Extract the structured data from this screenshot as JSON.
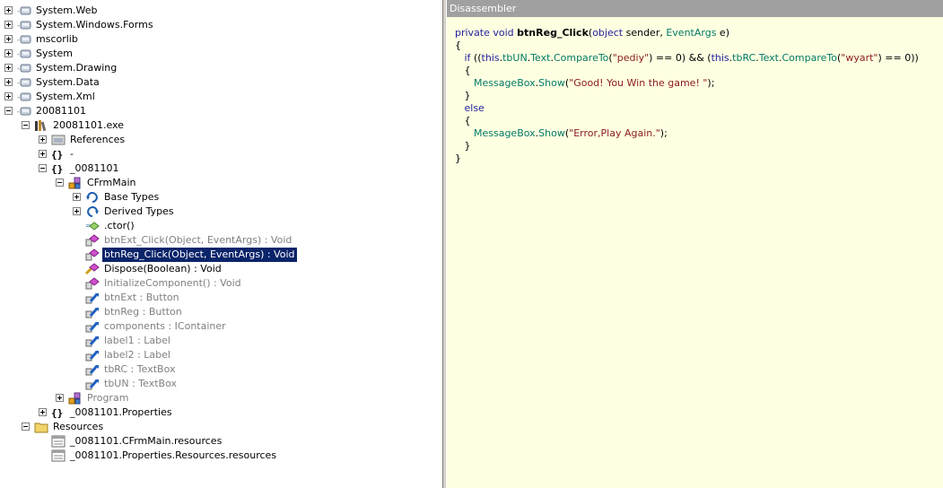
{
  "disassembler": {
    "title": "Disassembler",
    "code": [
      [
        [
          "kw",
          "private "
        ],
        [
          "kw",
          "void "
        ],
        [
          "nm",
          "btnReg_Click"
        ],
        [
          "pl",
          "("
        ],
        [
          "kw",
          "object "
        ],
        [
          "pl",
          "sender, "
        ],
        [
          "ty",
          "EventArgs "
        ],
        [
          "pl",
          "e)"
        ]
      ],
      [
        [
          "pl",
          "{"
        ]
      ],
      [
        [
          "pl",
          "   "
        ],
        [
          "kw",
          "if "
        ],
        [
          "pl",
          "(("
        ],
        [
          "kw",
          "this"
        ],
        [
          "pl",
          "."
        ],
        [
          "mb",
          "tbUN"
        ],
        [
          "pl",
          "."
        ],
        [
          "mb",
          "Text"
        ],
        [
          "pl",
          "."
        ],
        [
          "mb",
          "CompareTo"
        ],
        [
          "pl",
          "("
        ],
        [
          "st",
          "\"pediy\""
        ],
        [
          "pl",
          ") == 0) && ("
        ],
        [
          "kw",
          "this"
        ],
        [
          "pl",
          "."
        ],
        [
          "mb",
          "tbRC"
        ],
        [
          "pl",
          "."
        ],
        [
          "mb",
          "Text"
        ],
        [
          "pl",
          "."
        ],
        [
          "mb",
          "CompareTo"
        ],
        [
          "pl",
          "("
        ],
        [
          "st",
          "\"wyart\""
        ],
        [
          "pl",
          ") == 0))"
        ]
      ],
      [
        [
          "pl",
          "   {"
        ]
      ],
      [
        [
          "pl",
          "      "
        ],
        [
          "ty",
          "MessageBox"
        ],
        [
          "pl",
          "."
        ],
        [
          "mb",
          "Show"
        ],
        [
          "pl",
          "("
        ],
        [
          "st",
          "\"Good! You Win the game! \""
        ],
        [
          "pl",
          ");"
        ]
      ],
      [
        [
          "pl",
          "   }"
        ]
      ],
      [
        [
          "pl",
          "   "
        ],
        [
          "kw",
          "else"
        ]
      ],
      [
        [
          "pl",
          "   {"
        ]
      ],
      [
        [
          "pl",
          "      "
        ],
        [
          "ty",
          "MessageBox"
        ],
        [
          "pl",
          "."
        ],
        [
          "mb",
          "Show"
        ],
        [
          "pl",
          "("
        ],
        [
          "st",
          "\"Error,Play Again.\""
        ],
        [
          "pl",
          ");"
        ]
      ],
      [
        [
          "pl",
          "   }"
        ]
      ],
      [
        [
          "pl",
          "}"
        ]
      ]
    ]
  },
  "tree": [
    {
      "label": "System.Web",
      "icon": "assembly",
      "level": 0,
      "exp": "plus",
      "dim": false
    },
    {
      "label": "System.Windows.Forms",
      "icon": "assembly",
      "level": 0,
      "exp": "plus",
      "dim": false
    },
    {
      "label": "mscorlib",
      "icon": "assembly",
      "level": 0,
      "exp": "plus",
      "dim": false
    },
    {
      "label": "System",
      "icon": "assembly",
      "level": 0,
      "exp": "plus",
      "dim": false
    },
    {
      "label": "System.Drawing",
      "icon": "assembly",
      "level": 0,
      "exp": "plus",
      "dim": false
    },
    {
      "label": "System.Data",
      "icon": "assembly",
      "level": 0,
      "exp": "plus",
      "dim": false
    },
    {
      "label": "System.Xml",
      "icon": "assembly",
      "level": 0,
      "exp": "plus",
      "dim": false
    },
    {
      "label": "20081101",
      "icon": "assembly",
      "level": 0,
      "exp": "minus",
      "dim": false
    },
    {
      "label": "20081101.exe",
      "icon": "module",
      "level": 1,
      "exp": "minus",
      "dim": false
    },
    {
      "label": "References",
      "icon": "references",
      "level": 2,
      "exp": "plus",
      "dim": false
    },
    {
      "label": "-",
      "icon": "namespace",
      "level": 2,
      "exp": "plus",
      "dim": false
    },
    {
      "label": "_0081101",
      "icon": "namespace",
      "level": 2,
      "exp": "minus",
      "dim": false
    },
    {
      "label": "CFrmMain",
      "icon": "class",
      "level": 3,
      "exp": "minus",
      "dim": false
    },
    {
      "label": "Base Types",
      "icon": "base-types",
      "level": 4,
      "exp": "plus",
      "dim": false
    },
    {
      "label": "Derived Types",
      "icon": "derived-types",
      "level": 4,
      "exp": "plus",
      "dim": false
    },
    {
      "label": ".ctor()",
      "icon": "constructor",
      "level": 4,
      "exp": "none",
      "dim": false
    },
    {
      "label": "btnExt_Click(Object, EventArgs) : Void",
      "icon": "private-method",
      "level": 4,
      "exp": "none",
      "dim": true
    },
    {
      "label": "btnReg_Click(Object, EventArgs) : Void",
      "icon": "private-method",
      "level": 4,
      "exp": "none",
      "dim": false,
      "sel": true
    },
    {
      "label": "Dispose(Boolean) : Void",
      "icon": "protected-method",
      "level": 4,
      "exp": "none",
      "dim": false
    },
    {
      "label": "InitializeComponent() : Void",
      "icon": "private-method",
      "level": 4,
      "exp": "none",
      "dim": true
    },
    {
      "label": "btnExt : Button",
      "icon": "private-field",
      "level": 4,
      "exp": "none",
      "dim": true
    },
    {
      "label": "btnReg : Button",
      "icon": "private-field",
      "level": 4,
      "exp": "none",
      "dim": true
    },
    {
      "label": "components : IContainer",
      "icon": "private-field",
      "level": 4,
      "exp": "none",
      "dim": true
    },
    {
      "label": "label1 : Label",
      "icon": "private-field",
      "level": 4,
      "exp": "none",
      "dim": true
    },
    {
      "label": "label2 : Label",
      "icon": "private-field",
      "level": 4,
      "exp": "none",
      "dim": true
    },
    {
      "label": "tbRC : TextBox",
      "icon": "private-field",
      "level": 4,
      "exp": "none",
      "dim": true
    },
    {
      "label": "tbUN : TextBox",
      "icon": "private-field",
      "level": 4,
      "exp": "none",
      "dim": true
    },
    {
      "label": "Program",
      "icon": "class",
      "level": 3,
      "exp": "plus",
      "dim": true
    },
    {
      "label": "_0081101.Properties",
      "icon": "namespace",
      "level": 2,
      "exp": "plus",
      "dim": false
    },
    {
      "label": "Resources",
      "icon": "folder",
      "level": 1,
      "exp": "minus",
      "dim": false
    },
    {
      "label": "_0081101.CFrmMain.resources",
      "icon": "resource",
      "level": 2,
      "exp": "none",
      "dim": false
    },
    {
      "label": "_0081101.Properties.Resources.resources",
      "icon": "resource",
      "level": 2,
      "exp": "none",
      "dim": false
    }
  ]
}
